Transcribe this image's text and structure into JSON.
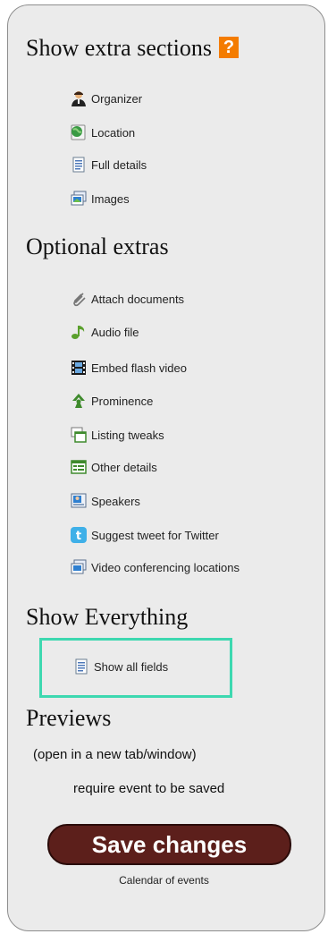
{
  "sections": {
    "show_extra": {
      "title": "Show extra sections",
      "help": "?",
      "items": [
        {
          "label": "Organizer",
          "icon": "organizer-icon"
        },
        {
          "label": "Location",
          "icon": "location-icon"
        },
        {
          "label": "Full details",
          "icon": "document-icon"
        },
        {
          "label": "Images",
          "icon": "images-icon"
        }
      ]
    },
    "optional_extras": {
      "title": "Optional extras",
      "items": [
        {
          "label": "Attach documents",
          "icon": "paperclip-icon"
        },
        {
          "label": "Audio file",
          "icon": "music-note-icon"
        },
        {
          "label": "Embed flash video",
          "icon": "film-icon"
        },
        {
          "label": "Prominence",
          "icon": "prominence-icon"
        },
        {
          "label": "Listing tweaks",
          "icon": "windows-icon"
        },
        {
          "label": "Other details",
          "icon": "form-icon"
        },
        {
          "label": "Speakers",
          "icon": "speakers-icon"
        },
        {
          "label": "Suggest tweet for Twitter",
          "icon": "twitter-icon"
        },
        {
          "label": "Video conferencing locations",
          "icon": "video-window-icon"
        }
      ]
    },
    "show_everything": {
      "title": "Show Everything",
      "item": {
        "label": "Show all fields",
        "icon": "document-icon"
      }
    },
    "previews": {
      "title": "Previews",
      "note": "(open in a new tab/window)",
      "requirement": "require event to be saved"
    }
  },
  "save_button": "Save changes",
  "footer_link": "Calendar of events",
  "colors": {
    "help_badge": "#f47c00",
    "save_button": "#5c1f1b",
    "highlight": "#3dd8b0"
  }
}
